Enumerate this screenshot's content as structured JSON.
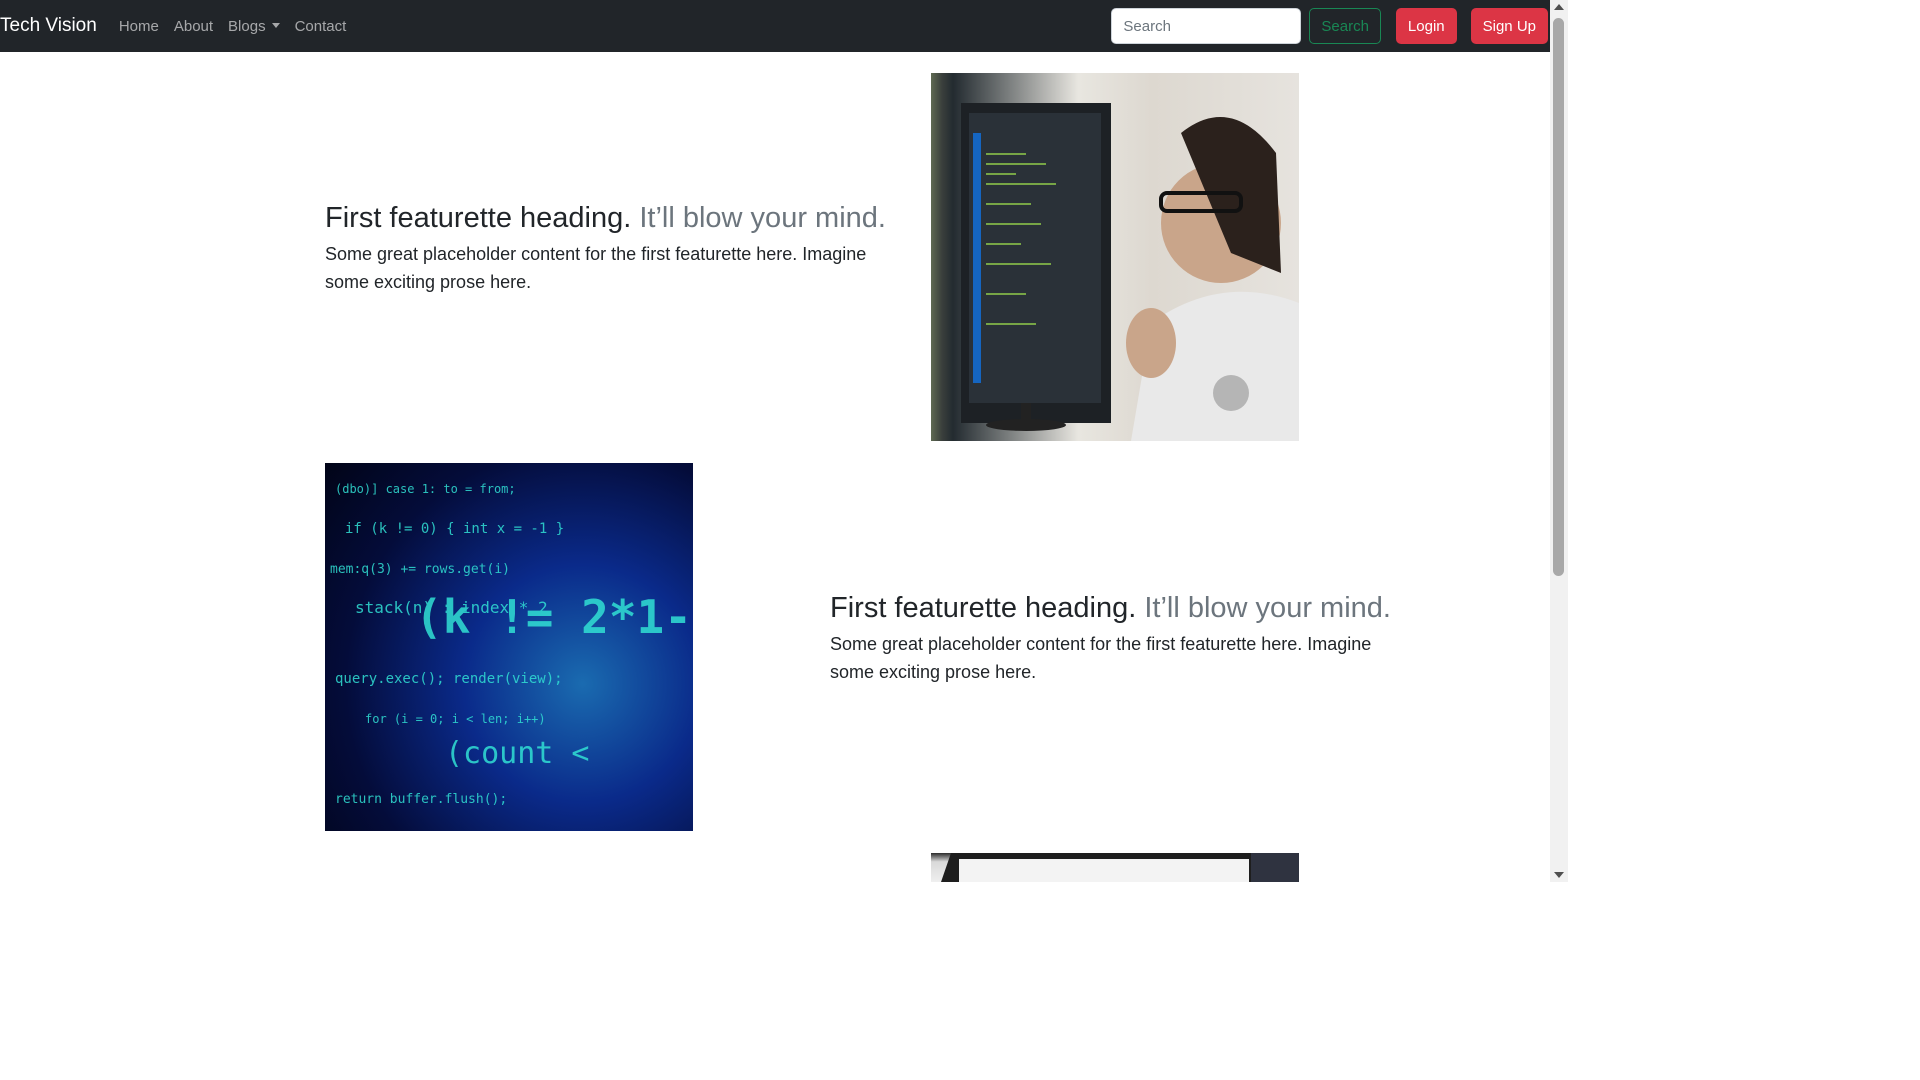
{
  "navbar": {
    "brand": "Tech Vision",
    "links": [
      {
        "label": "Home"
      },
      {
        "label": "About"
      },
      {
        "label": "Blogs"
      },
      {
        "label": "Contact"
      }
    ],
    "search": {
      "placeholder": "Search",
      "button_label": "Search"
    },
    "login_label": "Login",
    "signup_label": "Sign Up"
  },
  "featurettes": [
    {
      "heading": "First featurette heading.",
      "heading_muted": "It’ll blow your mind.",
      "lead": "Some great placeholder content for the first featurette here. Imagine some exciting prose here.",
      "image_icon": "woman-at-computer-photo"
    },
    {
      "heading": "First featurette heading.",
      "heading_muted": "It’ll blow your mind.",
      "lead": "Some great placeholder content for the first featurette here. Imagine some exciting prose here.",
      "image_icon": "code-matrix-photo"
    },
    {
      "image_icon": "laptop-photo"
    }
  ],
  "colors": {
    "navbar_bg": "#212529",
    "success": "#198754",
    "danger": "#dc3545",
    "muted_text": "#6c757d"
  }
}
